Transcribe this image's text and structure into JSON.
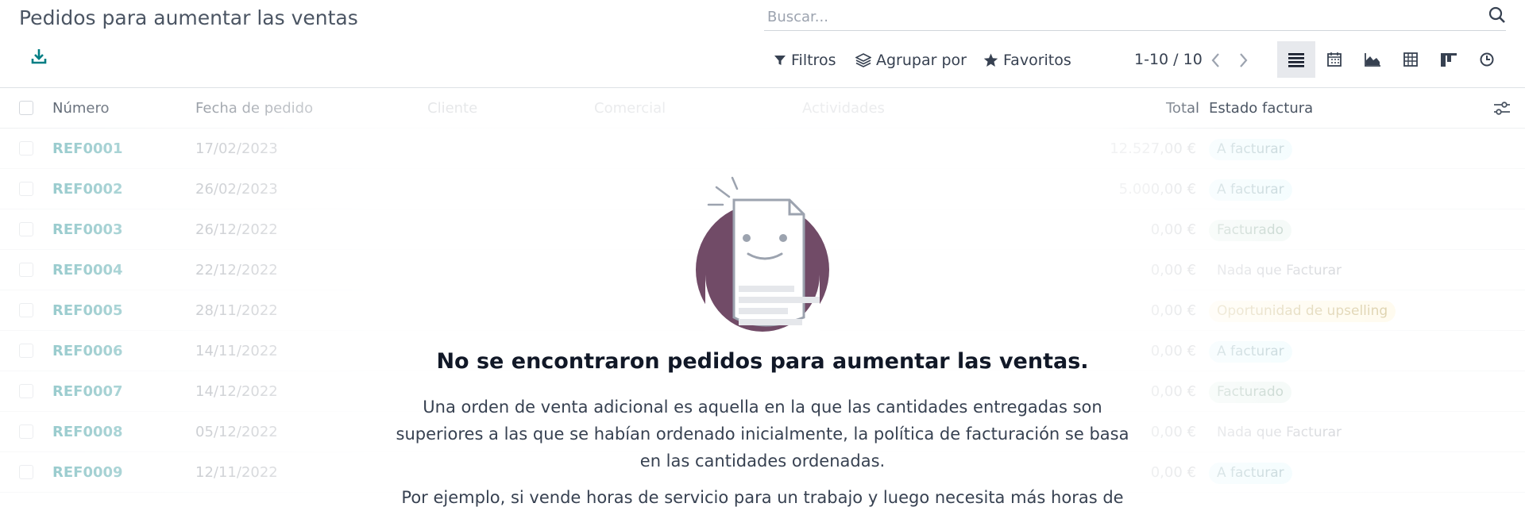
{
  "page_title": "Pedidos para aumentar las ventas",
  "search": {
    "placeholder": "Buscar..."
  },
  "filters": {
    "filtros": "Filtros",
    "agrupar": "Agrupar por",
    "favoritos": "Favoritos"
  },
  "pager": {
    "text": "1-10 / 10"
  },
  "views": [
    "list-view-icon",
    "calendar-view-icon",
    "graph-view-icon",
    "pivot-view-icon",
    "kanban-view-icon",
    "activity-view-icon"
  ],
  "columns": {
    "numero": "Número",
    "fecha": "Fecha de pedido",
    "cliente": "Cliente",
    "comercial": "Comercial",
    "actividades": "Actividades",
    "total": "Total",
    "estado": "Estado factura"
  },
  "rows": [
    {
      "numero": "REF0001",
      "fecha": "17/02/2023",
      "total": "12.527,00 €",
      "estado": "A facturar",
      "style": "info"
    },
    {
      "numero": "REF0002",
      "fecha": "26/02/2023",
      "total": "5.000,00 €",
      "estado": "A facturar",
      "style": "info"
    },
    {
      "numero": "REF0003",
      "fecha": "26/12/2022",
      "total": "0,00 €",
      "estado": "Facturado",
      "style": "success"
    },
    {
      "numero": "REF0004",
      "fecha": "22/12/2022",
      "total": "0,00 €",
      "estado": "Nada que Facturar",
      "style": "muted"
    },
    {
      "numero": "REF0005",
      "fecha": "28/11/2022",
      "total": "0,00 €",
      "estado": "Oportunidad de upselling",
      "style": "warning"
    },
    {
      "numero": "REF0006",
      "fecha": "14/11/2022",
      "total": "0,00 €",
      "estado": "A facturar",
      "style": "info"
    },
    {
      "numero": "REF0007",
      "fecha": "14/12/2022",
      "total": "0,00 €",
      "estado": "Facturado",
      "style": "success"
    },
    {
      "numero": "REF0008",
      "fecha": "05/12/2022",
      "total": "0,00 €",
      "estado": "Nada que Facturar",
      "style": "muted"
    },
    {
      "numero": "REF0009",
      "fecha": "12/11/2022",
      "total": "0,00 €",
      "estado": "A facturar",
      "style": "info"
    }
  ],
  "empty_state": {
    "title": "No se encontraron pedidos para aumentar las ventas.",
    "description": "Una orden de venta adicional es aquella en la que las cantidades entregadas son superiores a las que se habían ordenado inicialmente, la política de facturación se basa en las cantidades ordenadas.",
    "more": "Por ejemplo, si vende horas de servicio para un trabajo y luego necesita más horas de"
  },
  "colors": {
    "accent": "#017e84",
    "illustration": "#714b67"
  }
}
